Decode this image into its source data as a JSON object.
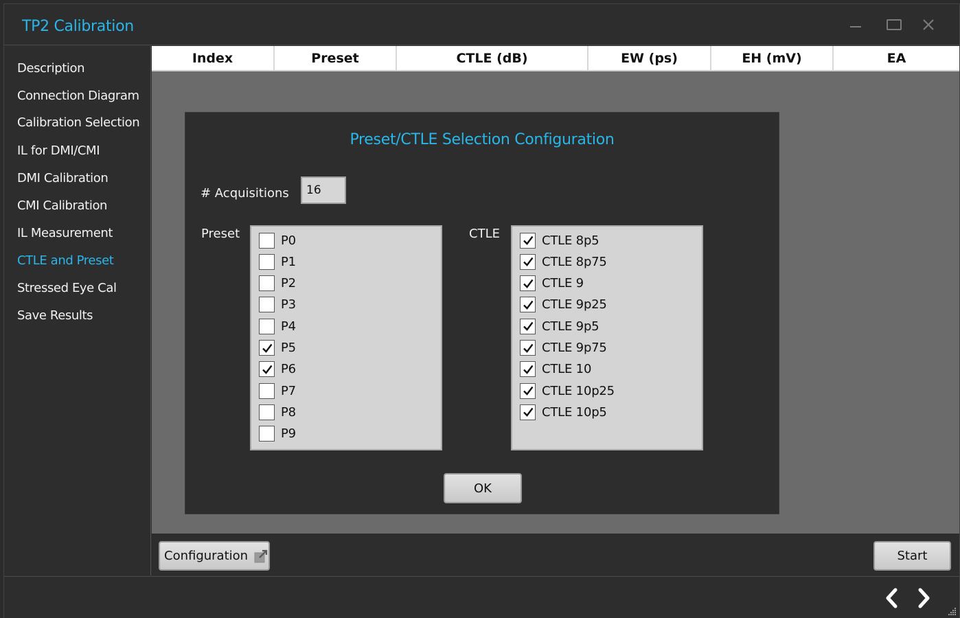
{
  "window": {
    "title": "TP2 Calibration"
  },
  "sidebar": {
    "items": [
      {
        "label": "Description",
        "active": false
      },
      {
        "label": "Connection Diagram",
        "active": false
      },
      {
        "label": "Calibration Selection",
        "active": false
      },
      {
        "label": "IL for DMI/CMI",
        "active": false
      },
      {
        "label": "DMI Calibration",
        "active": false
      },
      {
        "label": "CMI Calibration",
        "active": false
      },
      {
        "label": "IL Measurement",
        "active": false
      },
      {
        "label": "CTLE and Preset",
        "active": true
      },
      {
        "label": "Stressed Eye Cal",
        "active": false
      },
      {
        "label": "Save Results",
        "active": false
      }
    ]
  },
  "table": {
    "columns": [
      "Index",
      "Preset",
      "CTLE (dB)",
      "EW (ps)",
      "EH (mV)",
      "EA"
    ]
  },
  "dialog": {
    "title": "Preset/CTLE Selection Configuration",
    "acquisitions_label": "# Acquisitions",
    "acquisitions_value": "16",
    "preset_label": "Preset",
    "ctle_label": "CTLE",
    "presets": [
      {
        "label": "P0",
        "checked": false
      },
      {
        "label": "P1",
        "checked": false
      },
      {
        "label": "P2",
        "checked": false
      },
      {
        "label": "P3",
        "checked": false
      },
      {
        "label": "P4",
        "checked": false
      },
      {
        "label": "P5",
        "checked": true
      },
      {
        "label": "P6",
        "checked": true
      },
      {
        "label": "P7",
        "checked": false
      },
      {
        "label": "P8",
        "checked": false
      },
      {
        "label": "P9",
        "checked": false
      }
    ],
    "ctles": [
      {
        "label": "CTLE 8p5",
        "checked": true
      },
      {
        "label": "CTLE 8p75",
        "checked": true
      },
      {
        "label": "CTLE 9",
        "checked": true
      },
      {
        "label": "CTLE 9p25",
        "checked": true
      },
      {
        "label": "CTLE 9p5",
        "checked": true
      },
      {
        "label": "CTLE 9p75",
        "checked": true
      },
      {
        "label": "CTLE 10",
        "checked": true
      },
      {
        "label": "CTLE 10p25",
        "checked": true
      },
      {
        "label": "CTLE 10p5",
        "checked": true
      }
    ],
    "ok_label": "OK"
  },
  "toolbar": {
    "config_label": "Configuration",
    "config_icon": "external-link-icon",
    "start_label": "Start"
  },
  "footer": {
    "prev_icon": "chevron-left-icon",
    "next_icon": "chevron-right-icon"
  },
  "colors": {
    "accent": "#29b6e8",
    "background": "#2d2d2d",
    "content_area": "#6b6b6b",
    "listbox": "#d4d4d4"
  }
}
